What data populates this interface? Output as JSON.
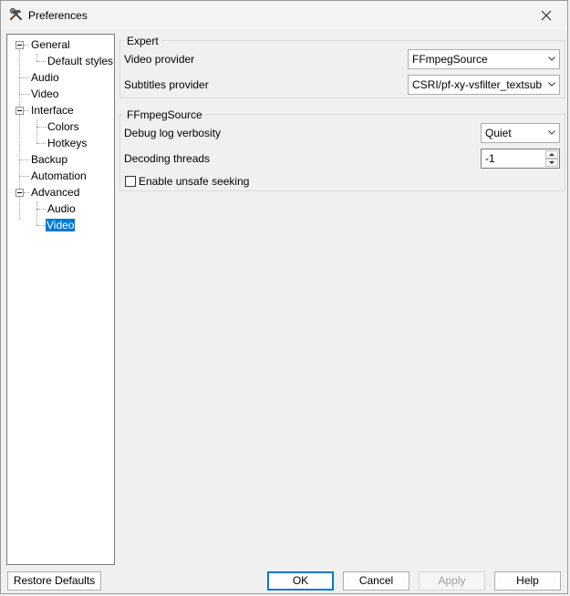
{
  "window": {
    "title": "Preferences"
  },
  "tree": {
    "items": [
      {
        "label": "General"
      },
      {
        "label": "Default styles"
      },
      {
        "label": "Audio"
      },
      {
        "label": "Video"
      },
      {
        "label": "Interface"
      },
      {
        "label": "Colors"
      },
      {
        "label": "Hotkeys"
      },
      {
        "label": "Backup"
      },
      {
        "label": "Automation"
      },
      {
        "label": "Advanced"
      },
      {
        "label": "Audio"
      },
      {
        "label": "Video"
      }
    ],
    "selected": "Video"
  },
  "expert": {
    "title": "Expert",
    "video_provider_label": "Video provider",
    "video_provider_value": "FFmpegSource",
    "subtitles_provider_label": "Subtitles provider",
    "subtitles_provider_value": "CSRI/pf-xy-vsfilter_textsub"
  },
  "ffms": {
    "title": "FFmpegSource",
    "debug_label": "Debug log verbosity",
    "debug_value": "Quiet",
    "threads_label": "Decoding threads",
    "threads_value": "-1",
    "unsafe_seek_label": "Enable unsafe seeking",
    "unsafe_seek_checked": false
  },
  "buttons": {
    "restore": "Restore Defaults",
    "ok": "OK",
    "cancel": "Cancel",
    "apply": "Apply",
    "help": "Help"
  },
  "colors": {
    "accent": "#0078d7"
  },
  "icons": {
    "app": "hammer-wrench-icon",
    "close": "close-icon"
  }
}
